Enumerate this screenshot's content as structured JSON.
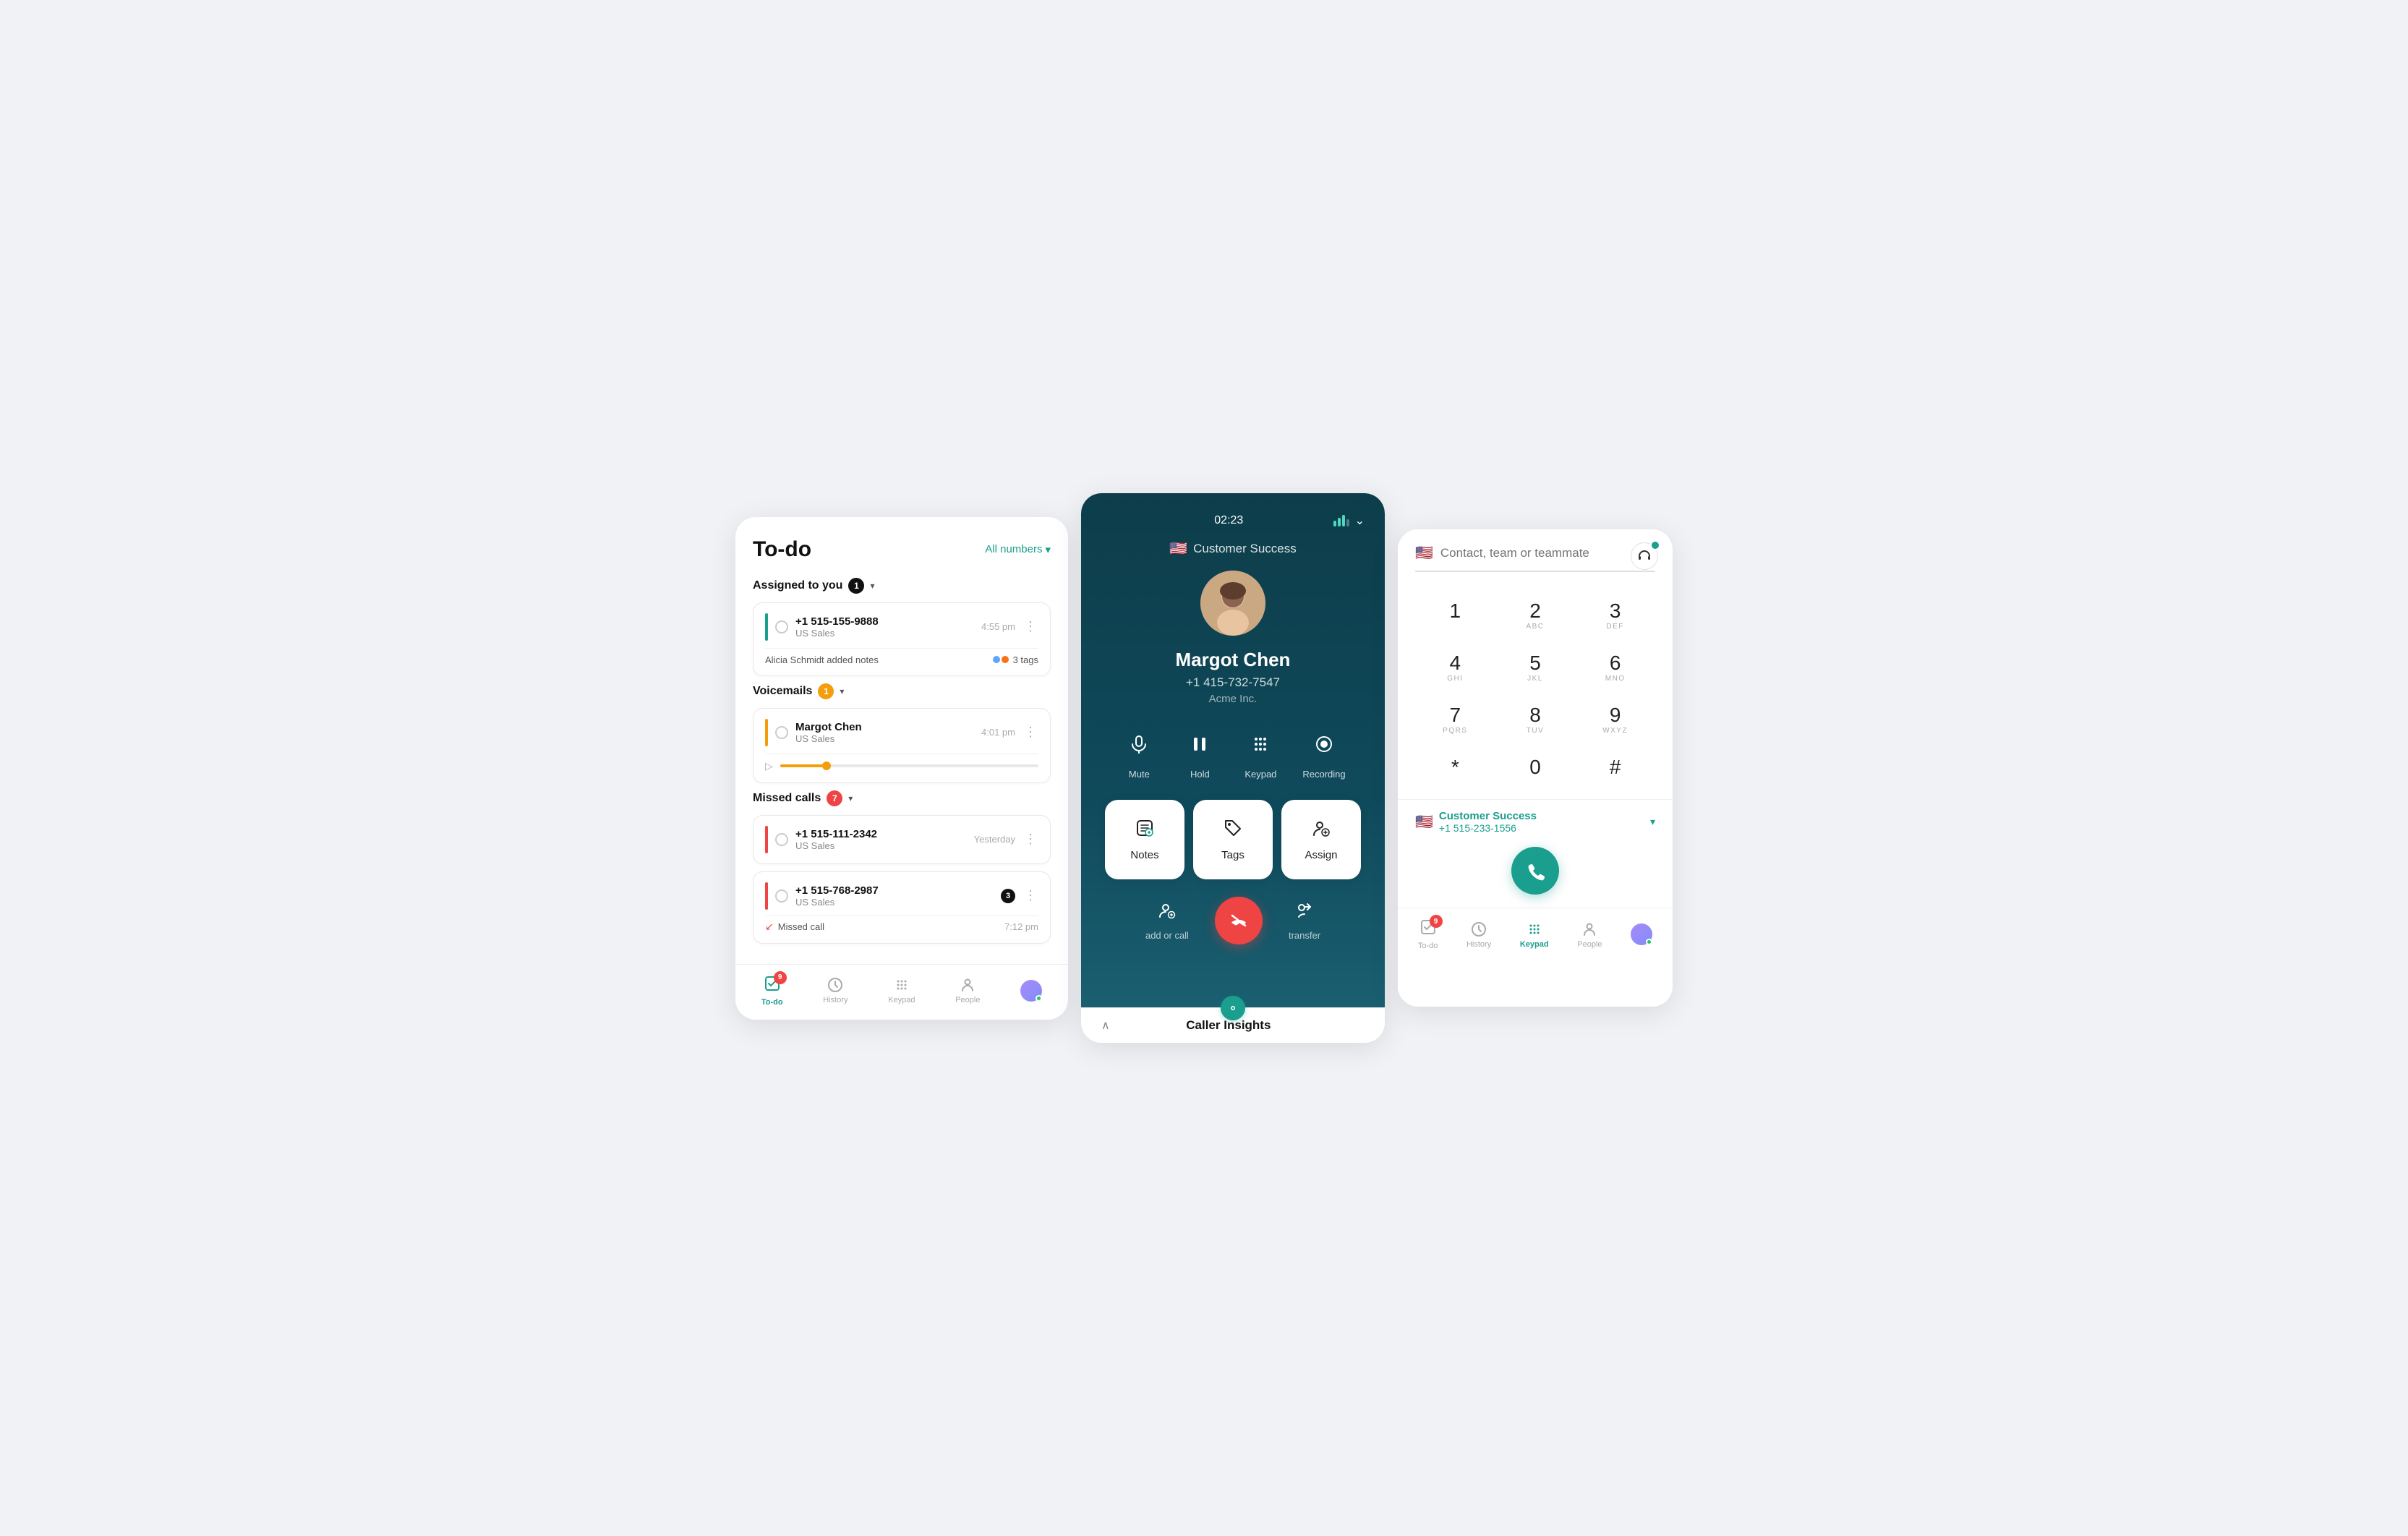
{
  "left": {
    "title": "To-do",
    "all_numbers": "All numbers",
    "sections": [
      {
        "name": "assigned",
        "label": "Assigned to you",
        "badge": "1",
        "items": [
          {
            "number": "+1 515-155-9888",
            "team": "US Sales",
            "time": "4:55 pm",
            "note": "Alicia Schmidt added notes",
            "tags": "3 tags",
            "indicator": "teal"
          }
        ]
      },
      {
        "name": "voicemails",
        "label": "Voicemails",
        "badge": "1",
        "items": [
          {
            "name": "Margot Chen",
            "team": "US Sales",
            "time": "4:01 pm",
            "indicator": "orange"
          }
        ]
      },
      {
        "name": "missed",
        "label": "Missed calls",
        "badge": "7",
        "items": [
          {
            "number": "+1 515-111-2342",
            "team": "US Sales",
            "time": "Yesterday",
            "indicator": "red"
          },
          {
            "number": "+1 515-768-2987",
            "team": "US Sales",
            "badge_num": "3",
            "indicator": "red",
            "missed_time": "7:12 pm"
          }
        ]
      }
    ],
    "nav": [
      {
        "label": "To-do",
        "icon": "✓",
        "active": true,
        "badge": "9"
      },
      {
        "label": "History",
        "icon": "↺",
        "active": false
      },
      {
        "label": "Keypad",
        "icon": "⠿",
        "active": false
      },
      {
        "label": "People",
        "icon": "👤",
        "active": false
      }
    ]
  },
  "middle": {
    "timer": "02:23",
    "team": "Customer Success",
    "caller_name": "Margot Chen",
    "caller_number": "+1 415-732-7547",
    "caller_company": "Acme Inc.",
    "actions": [
      {
        "label": "Mute",
        "icon": "🎤"
      },
      {
        "label": "Hold",
        "icon": "⏸"
      },
      {
        "label": "Keypad",
        "icon": "⠿"
      },
      {
        "label": "Recording",
        "icon": "⏺"
      }
    ],
    "cards": [
      {
        "label": "Notes",
        "icon": "✏️"
      },
      {
        "label": "Tags",
        "icon": "🏷️"
      },
      {
        "label": "Assign",
        "icon": "👤"
      }
    ],
    "add_call_label": "add or call",
    "transfer_label": "transfer",
    "insights_label": "Caller Insights"
  },
  "right": {
    "search_placeholder": "Contact, team or teammate",
    "dialpad": [
      {
        "num": "1",
        "sub": ""
      },
      {
        "num": "2",
        "sub": "ABC"
      },
      {
        "num": "3",
        "sub": "DEF"
      },
      {
        "num": "4",
        "sub": "GHI"
      },
      {
        "num": "5",
        "sub": "JKL"
      },
      {
        "num": "6",
        "sub": "MNO"
      },
      {
        "num": "7",
        "sub": "PQRS"
      },
      {
        "num": "8",
        "sub": "TUV"
      },
      {
        "num": "9",
        "sub": "WXYZ"
      },
      {
        "num": "*",
        "sub": ""
      },
      {
        "num": "0",
        "sub": ""
      },
      {
        "num": "#",
        "sub": ""
      }
    ],
    "selected_team": "Customer Success",
    "selected_number": "+1 515-233-1556",
    "nav": [
      {
        "label": "To-do",
        "icon": "✓",
        "active": false,
        "badge": "9"
      },
      {
        "label": "History",
        "icon": "↺",
        "active": false
      },
      {
        "label": "Keypad",
        "icon": "⠿",
        "active": true
      },
      {
        "label": "People",
        "icon": "👤",
        "active": false
      }
    ]
  }
}
